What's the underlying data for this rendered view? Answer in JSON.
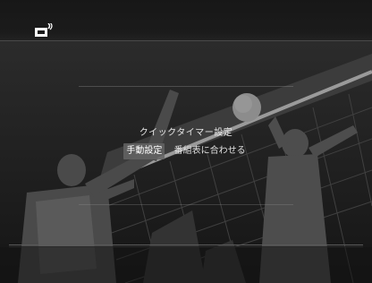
{
  "dialog": {
    "title": "クイックタイマー設定",
    "options": [
      {
        "label": "手動設定",
        "selected": true
      },
      {
        "label": "番組表に合わせる",
        "selected": false
      }
    ]
  },
  "icons": {
    "top_left": "tv-broadcast-icon"
  },
  "colors": {
    "text": "#e6e6e6",
    "selected_bg": "#646464"
  }
}
